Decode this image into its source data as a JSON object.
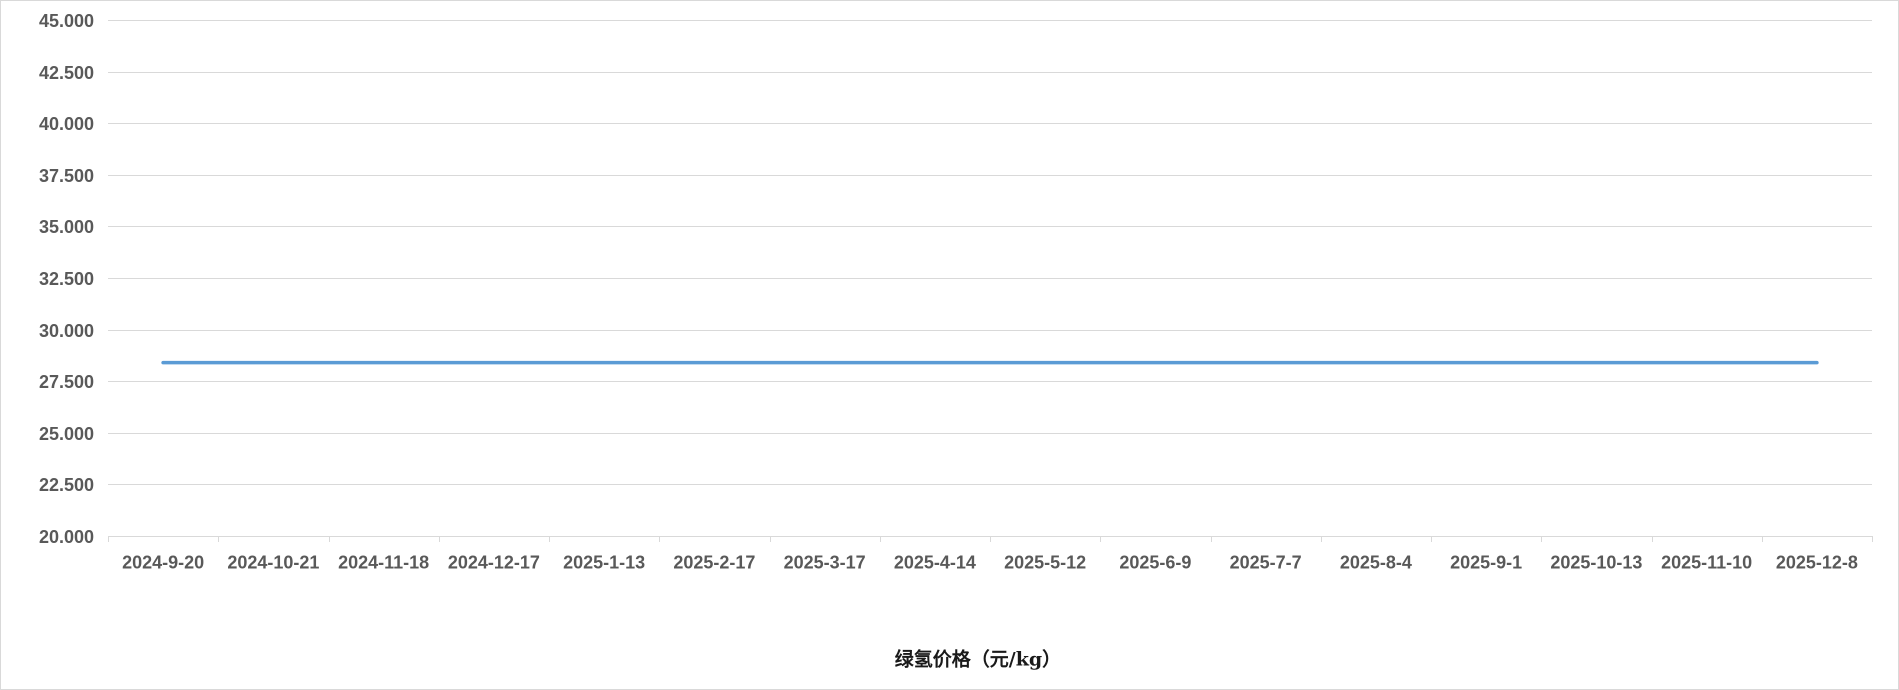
{
  "chart_data": {
    "type": "line",
    "categories": [
      "2024-9-20",
      "2024-10-21",
      "2024-11-18",
      "2024-12-17",
      "2025-1-13",
      "2025-2-17",
      "2025-3-17",
      "2025-4-14",
      "2025-5-12",
      "2025-6-9",
      "2025-7-7",
      "2025-8-4",
      "2025-9-1",
      "2025-10-13",
      "2025-11-10",
      "2025-12-8"
    ],
    "series": [
      {
        "name": "绿氢价格（元/kg）",
        "values": [
          28.4,
          28.4,
          28.4,
          28.4,
          28.4,
          28.4,
          28.4,
          28.4,
          28.4,
          28.4,
          28.4,
          28.4,
          28.4,
          28.4,
          28.4,
          28.4
        ],
        "color": "#5b9bd5"
      }
    ],
    "ylim": [
      20,
      45
    ],
    "yticks": [
      "20.000",
      "22.500",
      "25.000",
      "27.500",
      "30.000",
      "32.500",
      "35.000",
      "37.500",
      "40.000",
      "42.500",
      "45.000"
    ],
    "grid": true,
    "legend": "bottom"
  },
  "colors": {
    "gridline": "#d9d9d9",
    "tick_text": "#595959",
    "frame_border": "#d9d9d9"
  }
}
